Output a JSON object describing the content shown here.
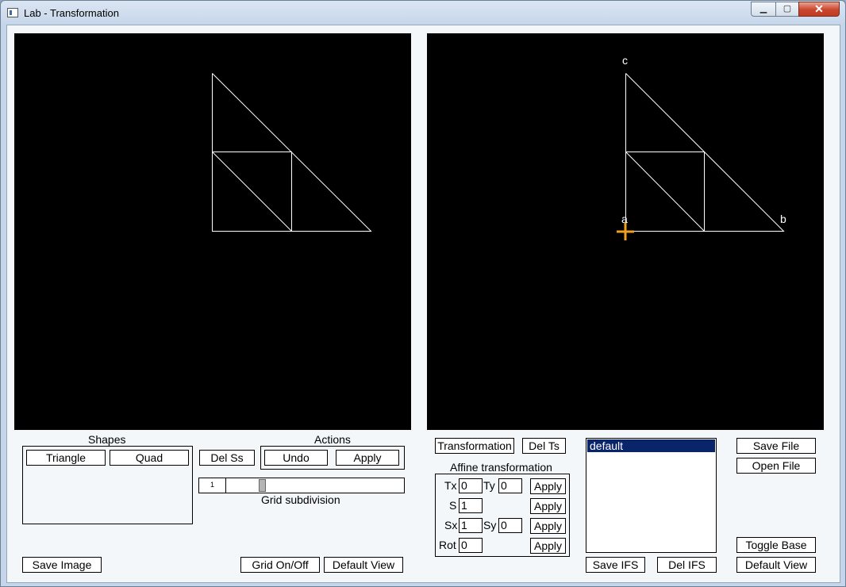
{
  "window": {
    "title": "Lab - Transformation",
    "min_label": "▁",
    "max_label": "▢",
    "close_label": "✕"
  },
  "colors": {
    "canvas_bg": "#000000",
    "shape_stroke": "#ffffff",
    "cursor": "#f0a020",
    "selection": "#0a246a"
  },
  "right_canvas": {
    "vertex_labels": {
      "a": "a",
      "b": "b",
      "c": "c"
    }
  },
  "shapes_panel": {
    "title": "Shapes",
    "triangle": "Triangle",
    "quad": "Quad"
  },
  "actions_panel": {
    "del_ss": "Del Ss",
    "title": "Actions",
    "undo": "Undo",
    "apply": "Apply"
  },
  "grid": {
    "value": "1",
    "label": "Grid subdivision",
    "position": 0.19
  },
  "bottom_left": {
    "save_image": "Save Image",
    "grid_toggle": "Grid On/Off",
    "default_view": "Default View"
  },
  "transform_panel": {
    "transformation": "Transformation",
    "del_ts": "Del Ts",
    "affine_title": "Affine transformation",
    "tx_label": "Tx",
    "tx_value": "0",
    "ty_label": "Ty",
    "ty_value": "0",
    "s_label": "S",
    "s_value": "1",
    "sx_label": "Sx",
    "sx_value": "1",
    "sy_label": "Sy",
    "sy_value": "0",
    "rot_label": "Rot",
    "rot_value": "0",
    "apply": "Apply"
  },
  "ifs_panel": {
    "items": [
      "default"
    ],
    "save_ifs": "Save IFS",
    "del_ifs": "Del IFS"
  },
  "file_panel": {
    "save_file": "Save File",
    "open_file": "Open File",
    "toggle_base": "Toggle Base",
    "default_view": "Default View"
  }
}
